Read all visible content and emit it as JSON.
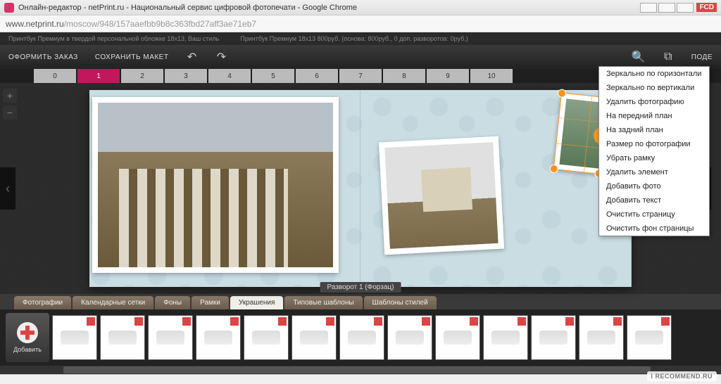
{
  "window": {
    "title": "Онлайн-редактор - netPrint.ru - Национальный сервис цифровой фотопечати - Google Chrome",
    "fcd": "FCD"
  },
  "address": {
    "host": "www.netprint.ru",
    "path": "/moscow/948/157aaefbb9b8c363fbd27aff3ae71eb7"
  },
  "infobar": {
    "left": "Принтбук Премиум в твердой персональной обложке 18х13, Ваш стиль",
    "right": "Принтбук Премиум 18х13  800руб. (основа: 800руб., 0 доп. разворотов: 0руб.)"
  },
  "toolbar": {
    "order": "ОФОРМИТЬ  ЗАКАЗ",
    "save": "СОХРАНИТЬ МАКЕТ",
    "share": "ПОДЕ"
  },
  "pages": [
    "0",
    "1",
    "2",
    "3",
    "4",
    "5",
    "6",
    "7",
    "8",
    "9",
    "10"
  ],
  "active_page_index": 1,
  "spread_label": "Разворот 1 (Форзац)",
  "context_menu": [
    "Зеркально по горизонтали",
    "Зеркально по вертикали",
    "Удалить фотографию",
    "На передний план",
    "На задний план",
    "Размер по фотографии",
    "Убрать рамку",
    "Удалить элемент",
    "Добавить фото",
    "Добавить текст",
    "Очистить страницу",
    "Очистить фон страницы"
  ],
  "gallery_tabs": [
    "Фотографии",
    "Календарные сетки",
    "Фоны",
    "Рамки",
    "Украшения",
    "Типовые шаблоны",
    "Шаблоны стилей"
  ],
  "active_gallery_tab_index": 4,
  "add_label": "Добавить",
  "thumb_count": 13,
  "watermark": "I RECOMMEND.RU"
}
